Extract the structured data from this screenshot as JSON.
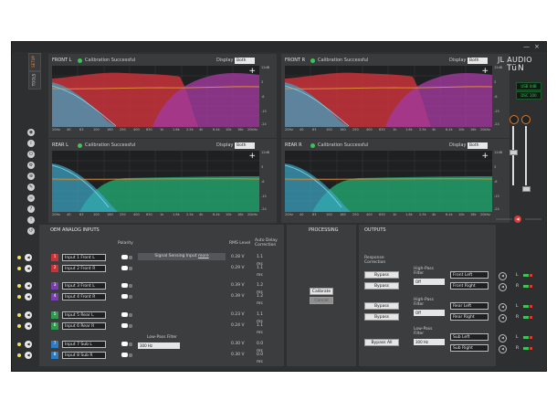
{
  "window": {
    "minimize": "—",
    "close": "×"
  },
  "sidetabs": [
    {
      "label": "SETUP",
      "active": true
    },
    {
      "label": "TOOLS",
      "active": false
    }
  ],
  "left_icons": [
    "dsp-icon",
    "info-icon",
    "power-icon",
    "settings-icon",
    "network-icon",
    "wrench-icon",
    "link-icon",
    "help-icon",
    "alert-icon",
    "reset-icon"
  ],
  "graphs": [
    {
      "name": "FRONT L",
      "status": "Calibration Successful",
      "display_label": "Display",
      "display_value": "Both"
    },
    {
      "name": "FRONT R",
      "status": "Calibration Successful",
      "display_label": "Display",
      "display_value": "Both"
    },
    {
      "name": "REAR L",
      "status": "Calibration Successful",
      "display_label": "Display",
      "display_value": "Both"
    },
    {
      "name": "REAR R",
      "status": "Calibration Successful",
      "display_label": "Display",
      "display_value": "Both"
    }
  ],
  "x_ticks": [
    "20Hz",
    "40",
    "63",
    "100",
    "160",
    "250",
    "400",
    "630",
    "1k",
    "1.6k",
    "2.5k",
    "4k",
    "6.4k",
    "10k",
    "16k",
    "20kHz"
  ],
  "y_ticks": [
    "12dB",
    "9",
    "6",
    "3",
    "0",
    "-3",
    "-6",
    "-9",
    "-12",
    "-15",
    "-18",
    "-21",
    "-24"
  ],
  "logo": {
    "line1": "JL AUDIO",
    "line2": "TüN"
  },
  "lcd": [
    "USB 0dB",
    "DSC 100"
  ],
  "oem": {
    "title": "OEM ANALOG INPUTS",
    "polarity": "Polarity",
    "rms_header": "RMS Level",
    "delay_header": "Auto Delay Correction",
    "sensing": {
      "prefix": "Signal Sensing Input",
      "link": "more"
    },
    "lowpass_label": "Low-Pass Filter",
    "lowpass_value": "300 Hz",
    "inputs": [
      {
        "num": "1",
        "name": "Input 1 Front L",
        "rms": "0.28 V",
        "delay": "1.1 ms",
        "color": "#c8333a"
      },
      {
        "num": "2",
        "name": "Input 2 Front R",
        "rms": "0.29 V",
        "delay": "1.1 ms",
        "color": "#c8333a"
      },
      {
        "num": "3",
        "name": "Input 3 Front L",
        "rms": "0.39 V",
        "delay": "1.2 ms",
        "color": "#7a3fae"
      },
      {
        "num": "4",
        "name": "Input 4 Front R",
        "rms": "0.39 V",
        "delay": "1.2 ms",
        "color": "#7a3fae"
      },
      {
        "num": "5",
        "name": "Input 5 Rear L",
        "rms": "0.23 V",
        "delay": "1.1 ms",
        "color": "#2f9a4f"
      },
      {
        "num": "6",
        "name": "Input 6 Rear R",
        "rms": "0.24 V",
        "delay": "1.1 ms",
        "color": "#2f9a4f"
      },
      {
        "num": "7",
        "name": "Input 7 Sub L",
        "rms": "0.30 V",
        "delay": "0.0 ms",
        "color": "#2f7bc0"
      },
      {
        "num": "8",
        "name": "Input 8 Sub R",
        "rms": "0.30 V",
        "delay": "0.0 ms",
        "color": "#2f7bc0"
      }
    ]
  },
  "processing": {
    "title": "PROCESSING",
    "calibrate": "Calibrate",
    "cancel": "Cancel"
  },
  "outputs": {
    "title": "OUTPUTS",
    "response_label": "Response Correction",
    "bypass": "Bypass",
    "bypass_all": "Bypass All",
    "hp_label": "High-Pass Filter",
    "hp_value": "Off",
    "lp_label": "Low-Pass Filter",
    "lp_value": "300 Hz",
    "names": [
      "Front Left",
      "Front Right",
      "Rear Left",
      "Rear Right",
      "Sub Left",
      "Sub Right"
    ],
    "lr": [
      "L",
      "R",
      "L",
      "R",
      "L",
      "R"
    ]
  }
}
